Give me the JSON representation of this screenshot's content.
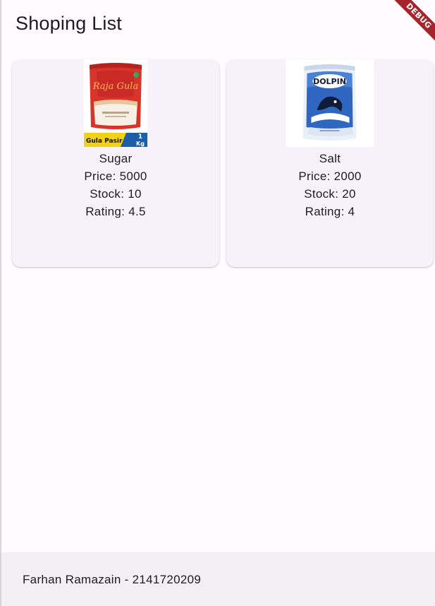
{
  "app_bar": {
    "title": "Shoping List",
    "debug_label": "DEBUG"
  },
  "products": [
    {
      "name": "Sugar",
      "price_text": "Price: 5000",
      "stock_text": "Stock: 10",
      "rating_text": "Rating: 4.5",
      "image": {
        "brand": "Raja Gula",
        "tag": "Gula Pasir",
        "weight_top": "1",
        "weight_bottom": "Kg"
      }
    },
    {
      "name": "Salt",
      "price_text": "Price: 2000",
      "stock_text": "Stock: 20",
      "rating_text": "Rating: 4",
      "image": {
        "brand": "DOLPIN"
      }
    }
  ],
  "footer": {
    "text": "Farhan Ramazain - 2141720209"
  },
  "colors": {
    "background": "#fffbfe",
    "card": "#f7f2fa",
    "footer": "#f3eff5",
    "debug_ribbon": "#a4262c"
  }
}
